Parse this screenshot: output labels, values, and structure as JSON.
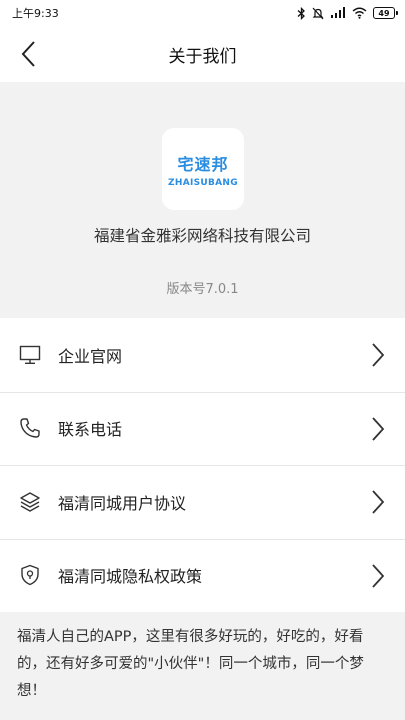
{
  "status_bar": {
    "time": "上午9:33",
    "battery": "49"
  },
  "nav": {
    "title": "关于我们"
  },
  "about": {
    "logo_main": "宅速邦",
    "logo_sub": "ZHAISUBANG",
    "company": "福建省金雅彩网络科技有限公司",
    "version": "版本号7.0.1"
  },
  "menu": {
    "items": [
      {
        "label": "企业官网",
        "icon": "monitor-icon"
      },
      {
        "label": "联系电话",
        "icon": "phone-icon"
      },
      {
        "label": "福清同城用户协议",
        "icon": "layers-icon"
      },
      {
        "label": "福清同城隐私权政策",
        "icon": "shield-icon"
      }
    ]
  },
  "footer": {
    "description": "福清人自己的APP，这里有很多好玩的，好吃的，好看的，还有好多可爱的\"小伙伴\"！同一个城市，同一个梦想！"
  }
}
